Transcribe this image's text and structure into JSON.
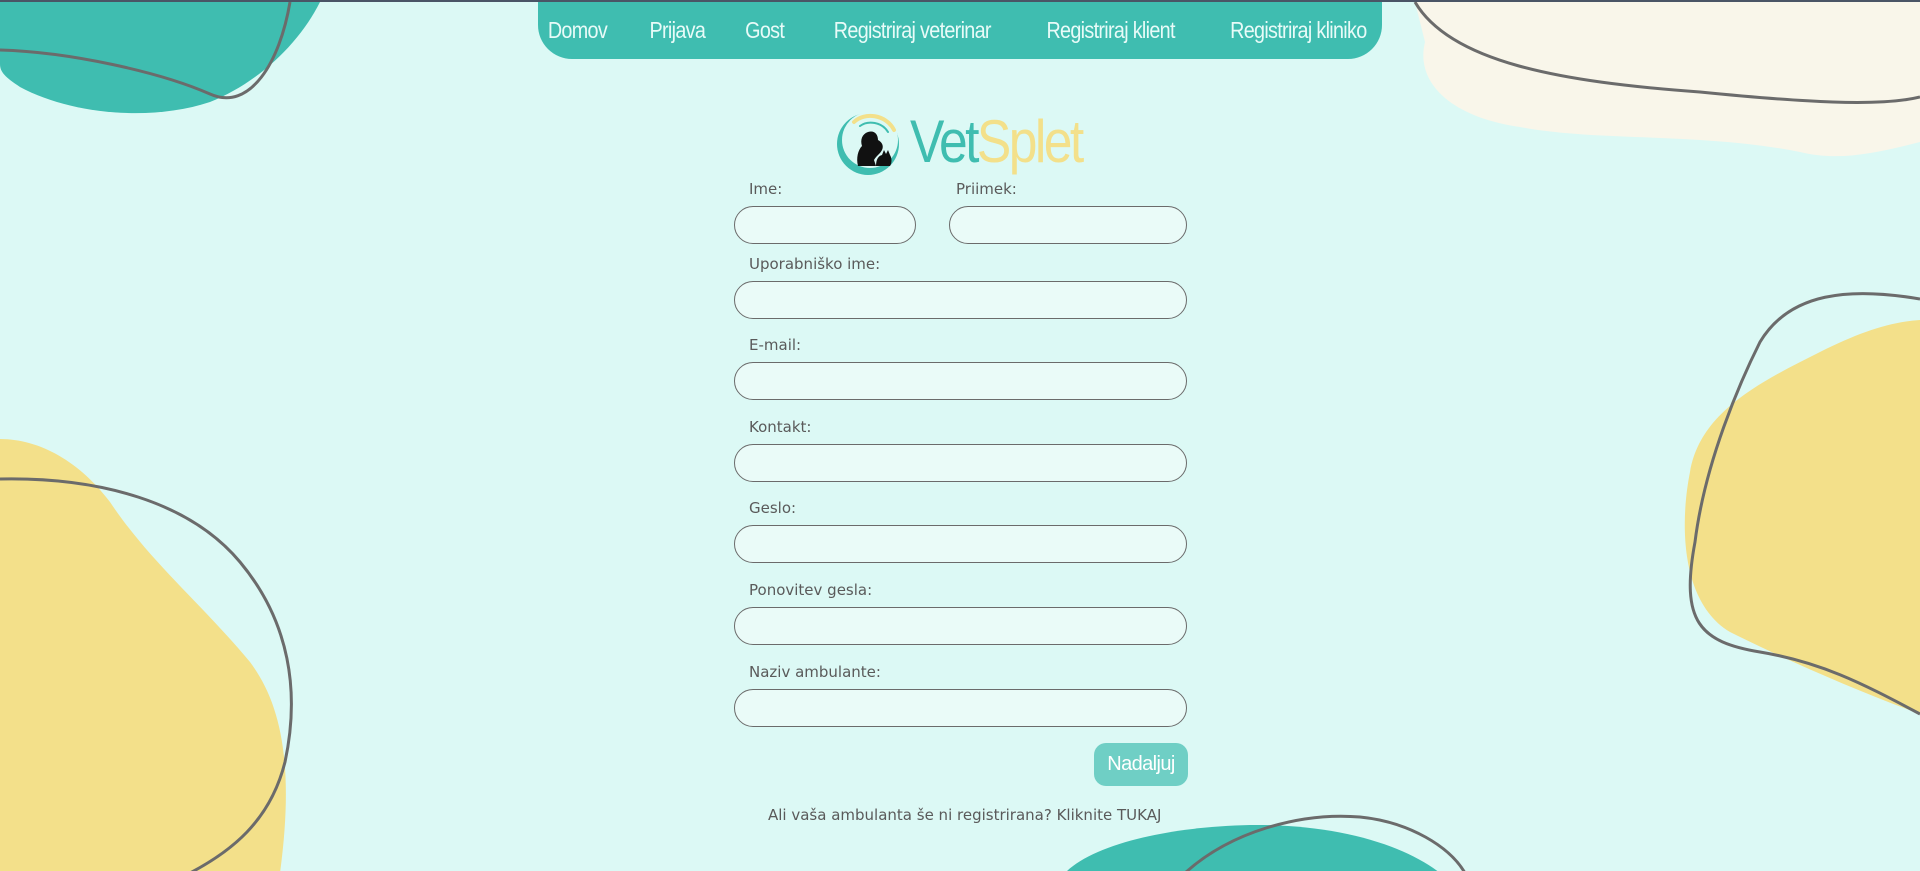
{
  "nav": {
    "items": [
      {
        "label": "Domov"
      },
      {
        "label": "Prijava"
      },
      {
        "label": "Gost"
      },
      {
        "label": "Registriraj veterinar"
      },
      {
        "label": "Registriraj klient"
      },
      {
        "label": "Registriraj kliniko"
      }
    ]
  },
  "logo": {
    "part1": "Vet",
    "part2": "Splet"
  },
  "form": {
    "ime_label": "Ime:",
    "priimek_label": "Priimek:",
    "uporabnisko_label": "Uporabniško ime:",
    "email_label": "E-mail:",
    "kontakt_label": "Kontakt:",
    "geslo_label": "Geslo:",
    "ponovitev_label": "Ponovitev gesla:",
    "ambulanta_label": "Naziv ambulante:",
    "ime_value": "",
    "priimek_value": "",
    "uporabnisko_value": "",
    "email_value": "",
    "kontakt_value": "",
    "geslo_value": "",
    "ponovitev_value": "",
    "ambulanta_value": "",
    "submit_label": "Nadaljuj"
  },
  "footer": {
    "text": "Ali vaša ambulanta še ni registrirana? Kliknite ",
    "link": "TUKAJ"
  },
  "colors": {
    "background": "#dcf9f5",
    "teal": "#3fbdb0",
    "yellow": "#f3e08a",
    "cream": "#f9f6ea",
    "button": "#6fcfc5"
  }
}
